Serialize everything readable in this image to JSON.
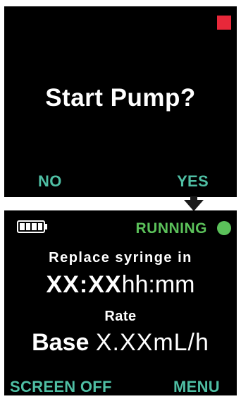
{
  "prompt_screen": {
    "question": "Start Pump?",
    "left_softkey": "NO",
    "right_softkey": "YES",
    "stop_indicator_color": "#e8283a",
    "icon": "stop-square-icon"
  },
  "transition": {
    "icon": "arrow-down-icon"
  },
  "running_screen": {
    "battery_icon": "battery-full-icon",
    "status": "RUNNING",
    "status_color": "#5bc15a",
    "status_icon": "status-dot-icon",
    "replace_label": "Replace syringe in",
    "time_value": "XX:XX",
    "time_unit": "hh:mm",
    "rate_label": "Rate",
    "rate_prefix": "Base",
    "rate_value": "X.XX",
    "rate_unit": "mL/h",
    "left_softkey": "SCREEN OFF",
    "right_softkey": "MENU",
    "softkey_color": "#4fbfa4"
  }
}
